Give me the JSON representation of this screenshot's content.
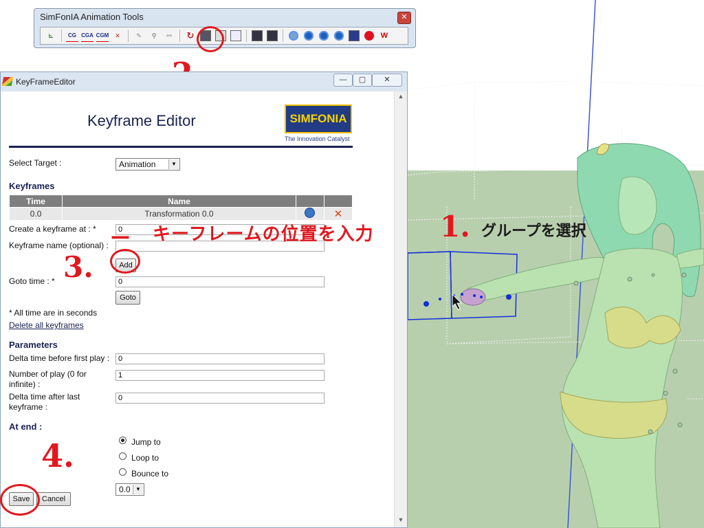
{
  "toolbar_window": {
    "title": "SimFonIA Animation Tools",
    "close_glyph": "✕",
    "buttons": [
      {
        "icon": "graph-icon",
        "glyph": "⊾"
      },
      {
        "icon": "cg-icon",
        "glyph": "CG"
      },
      {
        "icon": "cga-icon",
        "glyph": "CGA"
      },
      {
        "icon": "cgm-icon",
        "glyph": "CGM"
      },
      {
        "icon": "cross-axis-icon",
        "glyph": "✕"
      },
      {
        "icon": "wrench-icon",
        "glyph": "✎"
      },
      {
        "icon": "joint-icon",
        "glyph": "⚲"
      },
      {
        "icon": "link-icon",
        "glyph": "⚯"
      },
      {
        "icon": "rotate-arrow-icon",
        "glyph": "↻"
      },
      {
        "icon": "keyframe-editor-icon",
        "glyph": "▣"
      },
      {
        "icon": "camera-icon",
        "glyph": "◘"
      },
      {
        "icon": "chart-icon",
        "glyph": "⊿"
      },
      {
        "icon": "save-icon",
        "glyph": "▤"
      },
      {
        "icon": "save-as-icon",
        "glyph": "▤"
      },
      {
        "icon": "clock-icon",
        "glyph": "◷"
      },
      {
        "icon": "play-icon",
        "glyph": "▶"
      },
      {
        "icon": "pause-icon",
        "glyph": "❚❚"
      },
      {
        "icon": "rewind-icon",
        "glyph": "◀◀"
      },
      {
        "icon": "video-icon",
        "glyph": "▶"
      },
      {
        "icon": "record-icon",
        "glyph": "●"
      },
      {
        "icon": "w-icon",
        "glyph": "W"
      }
    ]
  },
  "editor_window": {
    "title": "KeyFrameEditor",
    "min_glyph": "—",
    "max_glyph": "▢",
    "close_glyph": "✕",
    "heading": "Keyframe Editor",
    "logo_text": "SIMFONIA",
    "logo_tagline": "The Innovation Catalyst",
    "select_target_label": "Select Target :",
    "select_target_value": "Animation",
    "keyframes_heading": "Keyframes",
    "table": {
      "headers": [
        "Time",
        "Name",
        "",
        ""
      ],
      "rows": [
        {
          "time": "0.0",
          "name": "Transformation 0.0"
        }
      ]
    },
    "create_keyframe_label": "Create a keyframe at : *",
    "create_keyframe_value": "0",
    "keyframe_name_label": "Keyframe name (optional) :",
    "keyframe_name_value": "",
    "add_button": "Add",
    "goto_label": "Goto time : *",
    "goto_value": "0",
    "goto_button": "Goto",
    "note": "* All time are in seconds",
    "delete_all_link": "Delete all keyframes",
    "parameters_heading": "Parameters",
    "delta_first_label": "Delta time before first play :",
    "delta_first_value": "0",
    "number_play_label_1": "Number of play (0 for",
    "number_play_label_2": "infinite) :",
    "number_play_value": "1",
    "delta_last_label_1": "Delta time after last",
    "delta_last_label_2": "keyframe :",
    "delta_last_value": "0",
    "at_end_heading": "At end :",
    "radio_options": [
      {
        "label": "Jump to",
        "checked": true
      },
      {
        "label": "Loop to",
        "checked": false
      },
      {
        "label": "Bounce to",
        "checked": false
      }
    ],
    "end_time_select": "0.0",
    "save_button": "Save",
    "cancel_button": "Cancel"
  },
  "annotations": {
    "step1": "1.",
    "step2": "2.",
    "step3": "3.",
    "step4": "4.",
    "dash": "ー",
    "jp_keyframe_position": "キーフレームの位置を入力",
    "jp_select_group": "グループを選択"
  },
  "colors": {
    "annotation_red": "#e0191f",
    "title_navy": "#1a2252",
    "logo_blue": "#213b84",
    "logo_yellow": "#f6d400",
    "ground_green": "#b8cfae",
    "selection_blue": "#1430d8"
  }
}
